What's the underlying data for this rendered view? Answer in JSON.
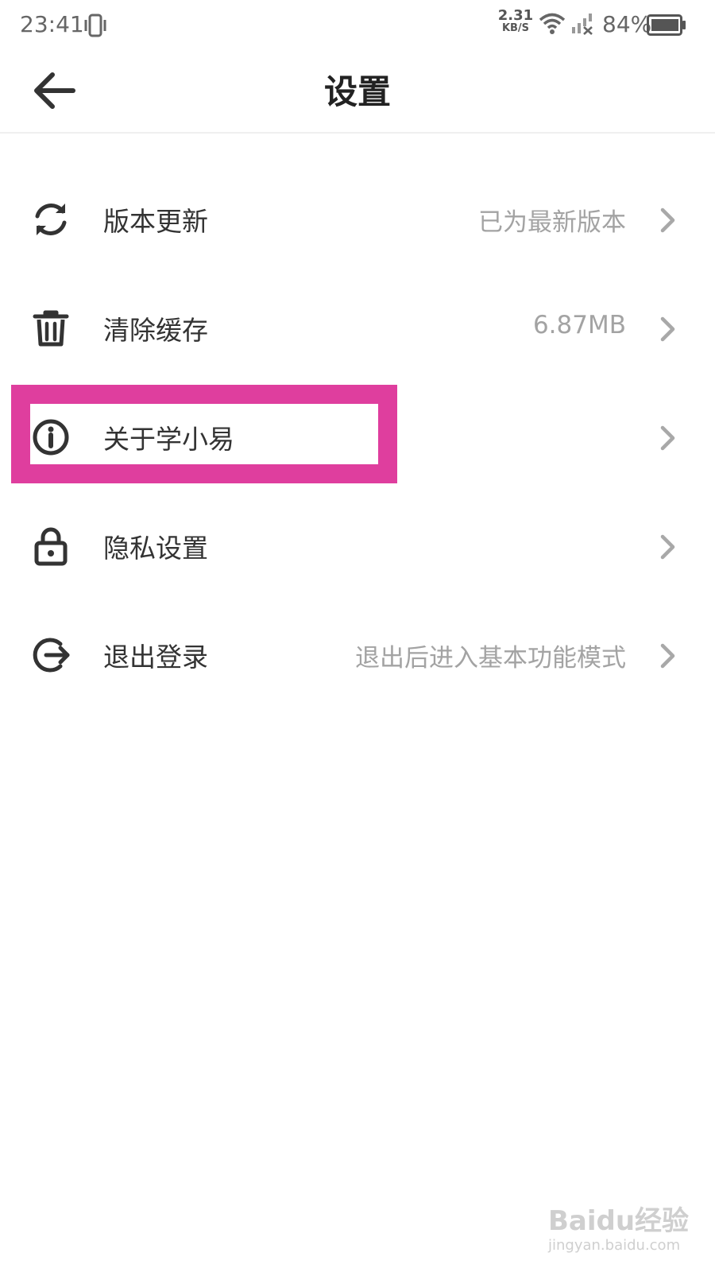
{
  "status_bar": {
    "time": "23:41",
    "speed_value": "2.31",
    "speed_unit": "KB/S",
    "battery": "84%"
  },
  "header": {
    "title": "设置"
  },
  "settings": [
    {
      "label": "版本更新",
      "value": "已为最新版本",
      "icon": "refresh-icon"
    },
    {
      "label": "清除缓存",
      "value": "6.87MB",
      "icon": "trash-icon"
    },
    {
      "label": "关于学小易",
      "value": "",
      "icon": "info-icon"
    },
    {
      "label": "隐私设置",
      "value": "",
      "icon": "lock-icon"
    },
    {
      "label": "退出登录",
      "value": "退出后进入基本功能模式",
      "icon": "logout-icon"
    }
  ],
  "annotation": {
    "highlight_color": "#df3e9e"
  },
  "watermark": {
    "brand": "Baidu经验",
    "url": "jingyan.baidu.com"
  }
}
